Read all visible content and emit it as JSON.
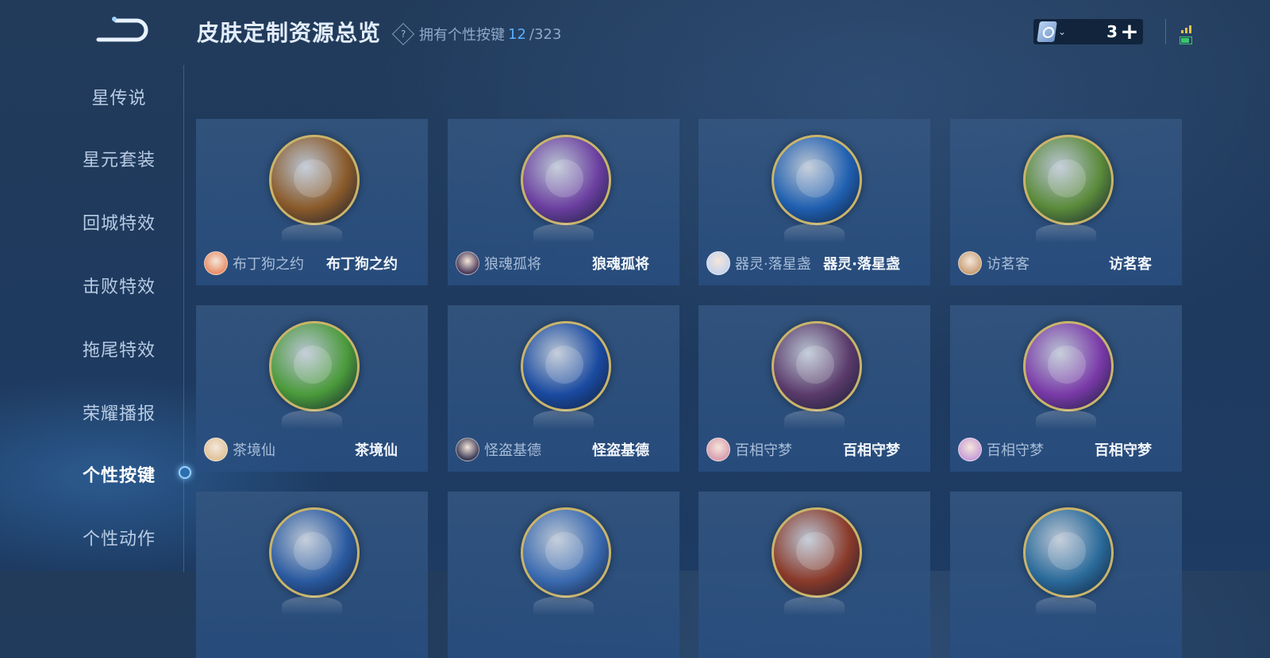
{
  "header": {
    "title": "皮肤定制资源总览",
    "help_icon": "?",
    "owned_label": "拥有个性按键",
    "owned_count": "12",
    "owned_total": "/323"
  },
  "currency": {
    "amount": "3",
    "plus": "+",
    "icon": "coupon-icon"
  },
  "sidebar": {
    "items": [
      {
        "label": "星传说"
      },
      {
        "label": "星元套装"
      },
      {
        "label": "回城特效"
      },
      {
        "label": "击败特效"
      },
      {
        "label": "拖尾特效"
      },
      {
        "label": "荣耀播报"
      },
      {
        "label": "个性按键",
        "active": true
      },
      {
        "label": "个性动作"
      }
    ]
  },
  "cards": [
    {
      "hero": "布丁狗之约",
      "skin": "布丁狗之约",
      "emblem_color": "#8a5a2a",
      "avatar_color": "#e8906a"
    },
    {
      "hero": "狼魂孤将",
      "skin": "狼魂孤将",
      "emblem_color": "#6b3fa0",
      "avatar_color": "#4a3a5a"
    },
    {
      "hero": "器灵·落星盏",
      "skin": "器灵·落星盏",
      "emblem_color": "#1f5fb0",
      "avatar_color": "#c8d4ec"
    },
    {
      "hero": "访茗客",
      "skin": "访茗客",
      "emblem_color": "#5a8a3a",
      "avatar_color": "#c9a27a"
    },
    {
      "hero": "茶境仙",
      "skin": "茶境仙",
      "emblem_color": "#4a9a3a",
      "avatar_color": "#e0c49a"
    },
    {
      "hero": "怪盗基德",
      "skin": "怪盗基德",
      "emblem_color": "#1a4aa0",
      "avatar_color": "#3a3a55"
    },
    {
      "hero": "百相守梦",
      "skin": "百相守梦",
      "emblem_color": "#5a3a6a",
      "avatar_color": "#d9a0b0"
    },
    {
      "hero": "百相守梦",
      "skin": "百相守梦",
      "emblem_color": "#7a3aa8",
      "avatar_color": "#c9a0d8"
    },
    {
      "hero": "",
      "skin": "",
      "emblem_color": "#2a5aa0",
      "avatar_color": ""
    },
    {
      "hero": "",
      "skin": "",
      "emblem_color": "#3a6ab0",
      "avatar_color": ""
    },
    {
      "hero": "",
      "skin": "",
      "emblem_color": "#8a3a2a",
      "avatar_color": ""
    },
    {
      "hero": "",
      "skin": "",
      "emblem_color": "#2a6a9a",
      "avatar_color": ""
    }
  ]
}
